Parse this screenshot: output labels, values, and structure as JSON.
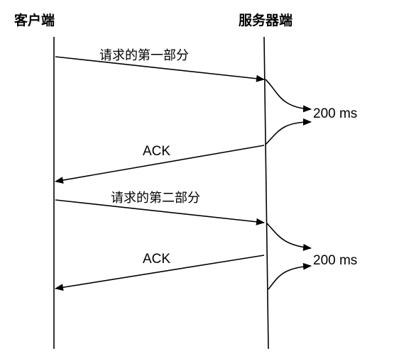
{
  "client": {
    "label": "客户端"
  },
  "server": {
    "label": "服务器端"
  },
  "messages": [
    {
      "label": "请求的第一部分"
    },
    {
      "label": "ACK"
    },
    {
      "label": "请求的第二部分"
    },
    {
      "label": "ACK"
    }
  ],
  "delays": [
    {
      "label": "200 ms"
    },
    {
      "label": "200 ms"
    }
  ]
}
